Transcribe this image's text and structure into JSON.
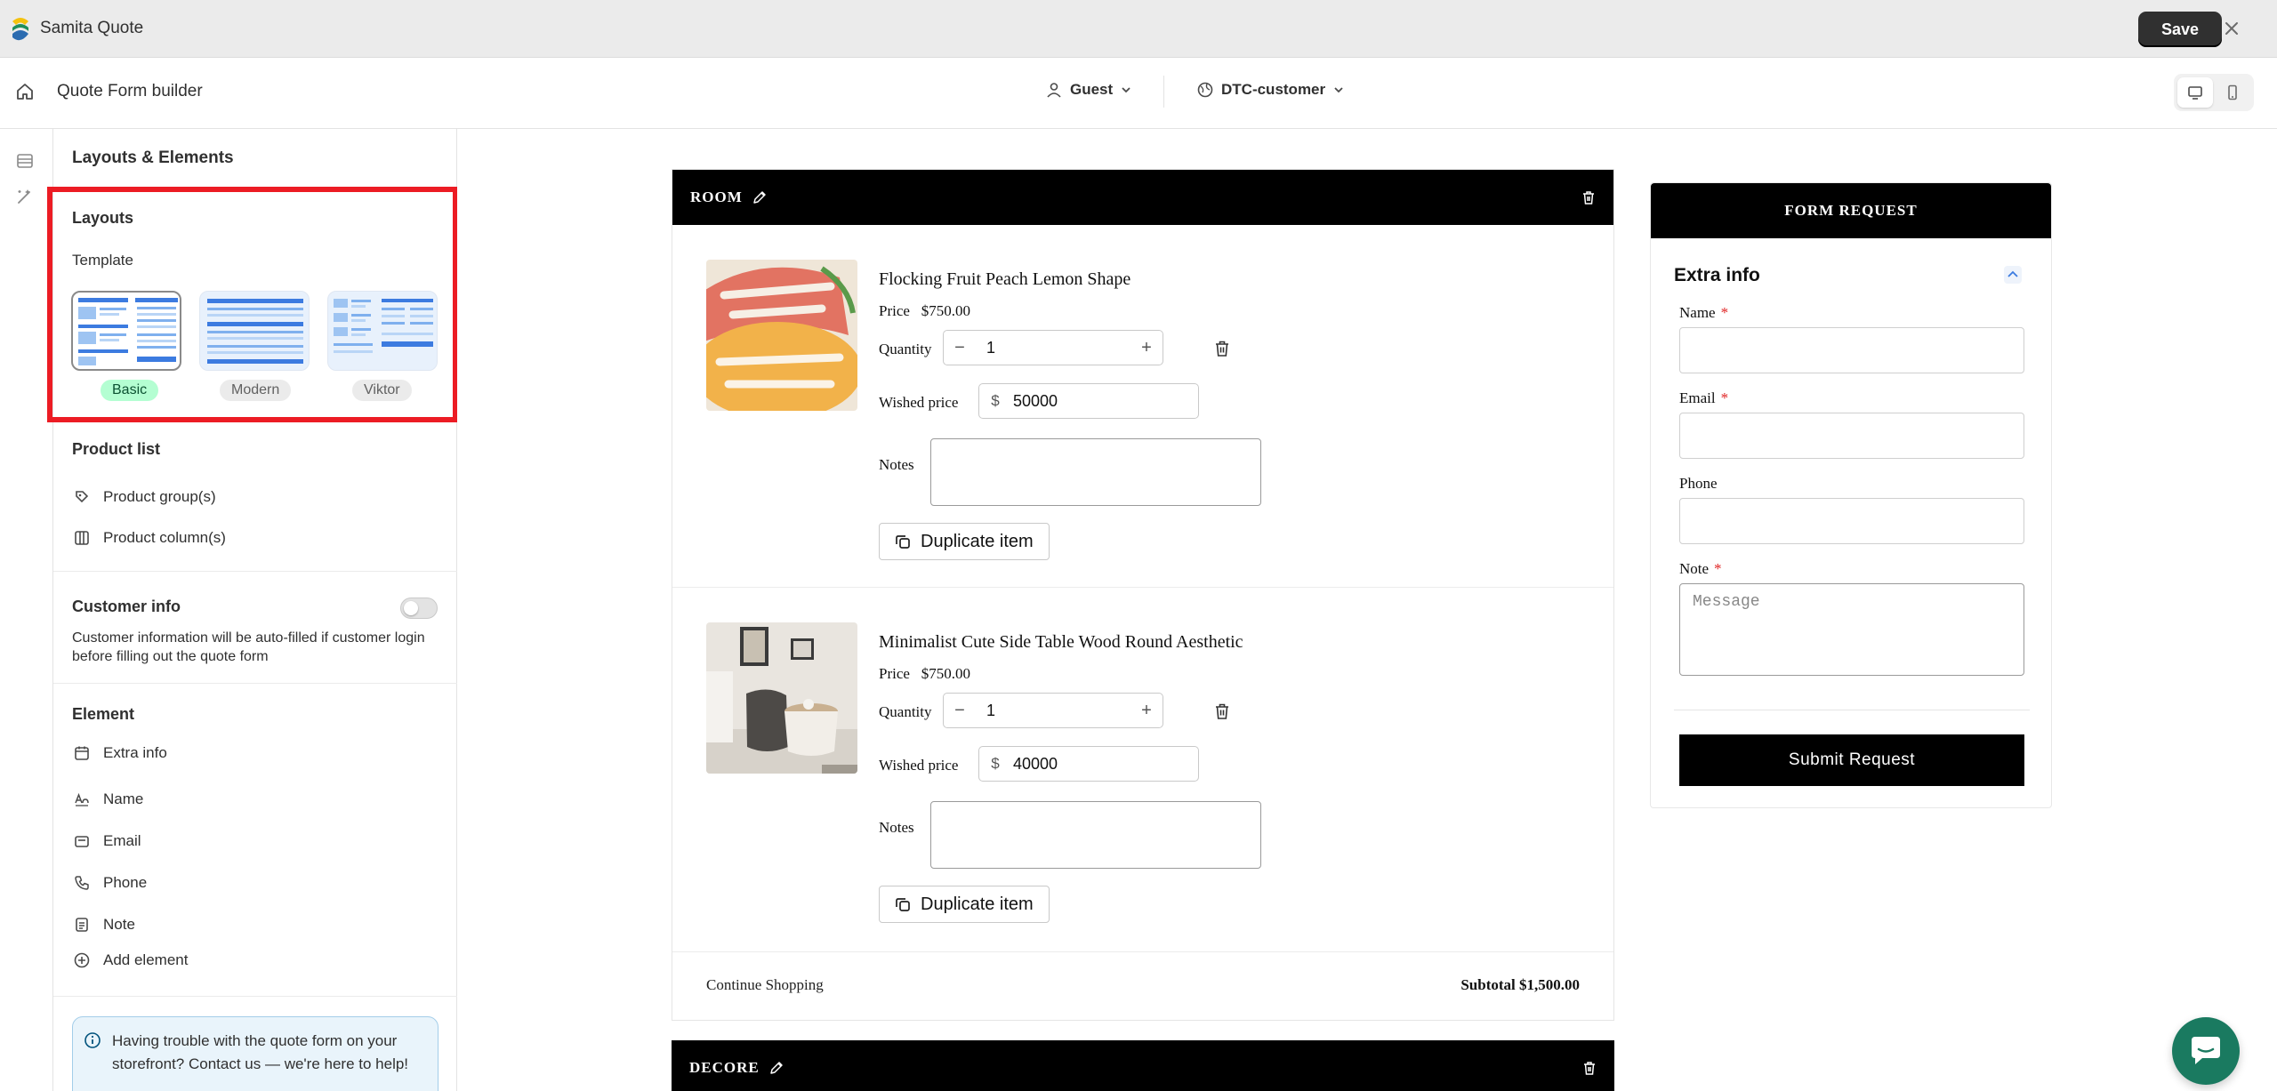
{
  "app": {
    "title": "Samita Quote",
    "save_label": "Save"
  },
  "header": {
    "title": "Quote Form builder",
    "guest_label": "Guest",
    "customer_label": "DTC-customer"
  },
  "sidebar": {
    "title": "Layouts & Elements",
    "layouts": {
      "title": "Layouts",
      "template_label": "Template",
      "templates": [
        {
          "label": "Basic",
          "selected": true
        },
        {
          "label": "Modern",
          "selected": false
        },
        {
          "label": "Viktor",
          "selected": false
        }
      ]
    },
    "product_list": {
      "title": "Product list",
      "group_label": "Product group(s)",
      "column_label": "Product column(s)"
    },
    "customer_info": {
      "title": "Customer info",
      "enabled": false,
      "description": "Customer information will be auto-filled if customer login before filling out the quote form"
    },
    "element": {
      "title": "Element",
      "items": [
        "Extra info",
        "Name",
        "Email",
        "Phone",
        "Note"
      ],
      "add_label": "Add element"
    },
    "help_text": "Having trouble with the quote form on your storefront? Contact us — we're here to help!"
  },
  "cart": {
    "group_title": "ROOM",
    "items": [
      {
        "name": "Flocking Fruit Peach Lemon Shape",
        "price_label": "Price",
        "price": "$750.00",
        "quantity_label": "Quantity",
        "quantity": "1",
        "wished_label": "Wished price",
        "currency": "$",
        "wished_price": "50000",
        "notes_label": "Notes",
        "duplicate_label": "Duplicate item"
      },
      {
        "name": "Minimalist Cute Side Table Wood Round Aesthetic",
        "price_label": "Price",
        "price": "$750.00",
        "quantity_label": "Quantity",
        "quantity": "1",
        "wished_label": "Wished price",
        "currency": "$",
        "wished_price": "40000",
        "notes_label": "Notes",
        "duplicate_label": "Duplicate item"
      }
    ],
    "continue_label": "Continue Shopping",
    "subtotal": "Subtotal $1,500.00",
    "second_group_title": "DECORE",
    "minus": "−",
    "plus": "+"
  },
  "form": {
    "header": "FORM REQUEST",
    "section_title": "Extra info",
    "fields": [
      {
        "label": "Name",
        "required": "*"
      },
      {
        "label": "Email",
        "required": "*"
      },
      {
        "label": "Phone",
        "required": ""
      },
      {
        "label": "Note",
        "required": "*"
      }
    ],
    "note_placeholder": "Message",
    "submit_label": "Submit Request"
  },
  "colors": {
    "accent_dark": "#303030",
    "highlight_red": "#ec1c24",
    "badge_green": "#b4fed2",
    "chat_green": "#1a7a60"
  }
}
